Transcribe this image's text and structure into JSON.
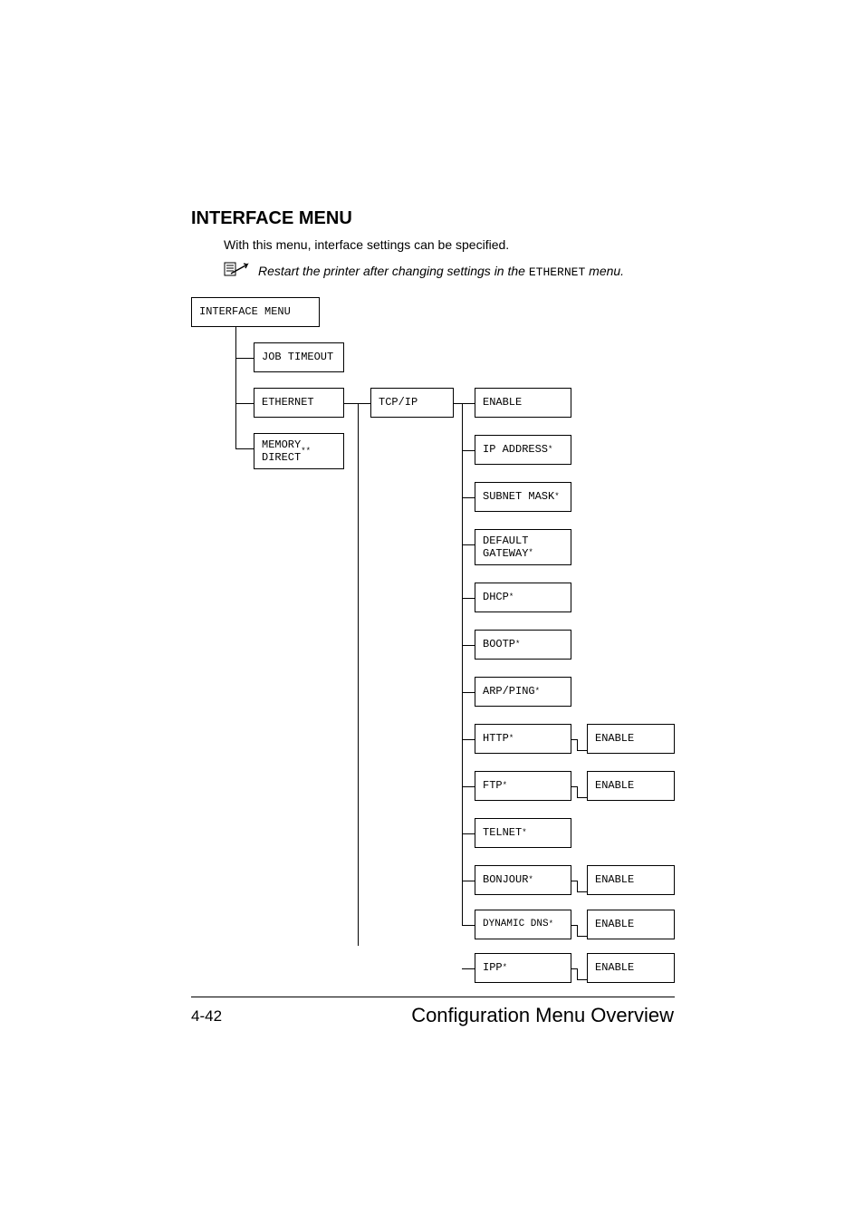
{
  "heading": "INTERFACE MENU",
  "intro": "With this menu, interface settings can be specified.",
  "note_prefix": "Restart the printer after changing settings in the ",
  "note_mono": "ETHERNET",
  "note_suffix": " menu.",
  "boxes": {
    "interface_menu": "INTERFACE MENU",
    "job_timeout": "JOB TIMEOUT",
    "ethernet": "ETHERNET",
    "memory_direct": "MEMORY\nDIRECT",
    "tcp_ip": "TCP/IP",
    "enable1": "ENABLE",
    "ip_address": "IP ADDRESS",
    "subnet_mask": "SUBNET MASK",
    "default_gateway": "DEFAULT\nGATEWAY",
    "dhcp": "DHCP",
    "bootp": "BOOTP",
    "arp_ping": "ARP/PING",
    "http": "HTTP",
    "ftp": "FTP",
    "telnet": "TELNET",
    "bonjour": "BONJOUR",
    "dynamic_dns": "DYNAMIC DNS",
    "ipp": "IPP",
    "enable_http": "ENABLE",
    "enable_ftp": "ENABLE",
    "enable_bonjour": "ENABLE",
    "enable_dyndns": "ENABLE",
    "enable_ipp": "ENABLE"
  },
  "footer": {
    "page_num": "4-42",
    "title": "Configuration Menu Overview"
  }
}
